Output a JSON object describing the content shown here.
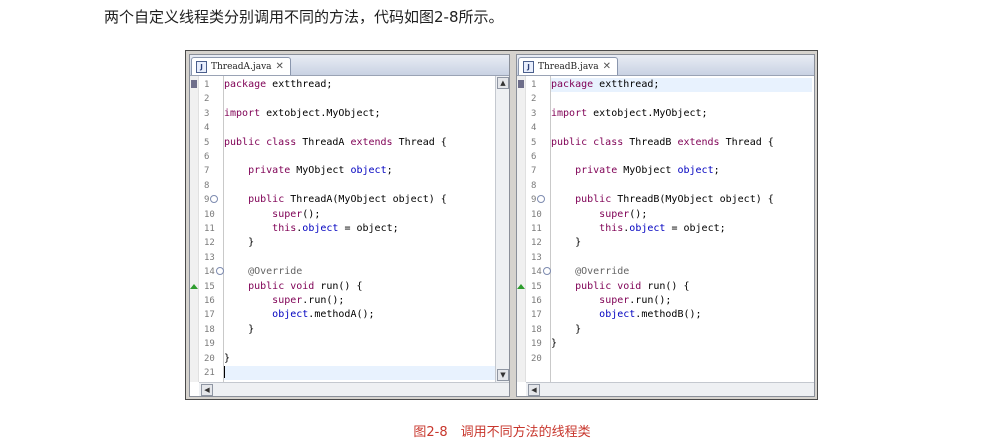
{
  "intro_text": "两个自定义线程类分别调用不同的方法，代码如图2-8所示。",
  "caption": "图2-8　调用不同方法的线程类",
  "editors": [
    {
      "tab_label": "ThreadA.java",
      "current_line": 21,
      "lines": [
        [
          {
            "t": "package",
            "c": "kw"
          },
          {
            "t": " extthread;"
          }
        ],
        [],
        [
          {
            "t": "import",
            "c": "kw"
          },
          {
            "t": " extobject.MyObject;"
          }
        ],
        [],
        [
          {
            "t": "public class",
            "c": "kw"
          },
          {
            "t": " ThreadA "
          },
          {
            "t": "extends",
            "c": "kw"
          },
          {
            "t": " Thread {"
          }
        ],
        [],
        [
          {
            "t": "    "
          },
          {
            "t": "private",
            "c": "kw"
          },
          {
            "t": " MyObject "
          },
          {
            "t": "object",
            "c": "fld"
          },
          {
            "t": ";"
          }
        ],
        [],
        [
          {
            "t": "    "
          },
          {
            "t": "public",
            "c": "kw"
          },
          {
            "t": " ThreadA(MyObject object) {"
          }
        ],
        [
          {
            "t": "        "
          },
          {
            "t": "super",
            "c": "kw"
          },
          {
            "t": "();"
          }
        ],
        [
          {
            "t": "        "
          },
          {
            "t": "this",
            "c": "kw"
          },
          {
            "t": "."
          },
          {
            "t": "object",
            "c": "fld"
          },
          {
            "t": " = object;"
          }
        ],
        [
          {
            "t": "    }"
          }
        ],
        [],
        [
          {
            "t": "    "
          },
          {
            "t": "@Override",
            "c": "ann"
          }
        ],
        [
          {
            "t": "    "
          },
          {
            "t": "public void",
            "c": "kw"
          },
          {
            "t": " run() {"
          }
        ],
        [
          {
            "t": "        "
          },
          {
            "t": "super",
            "c": "kw"
          },
          {
            "t": ".run();"
          }
        ],
        [
          {
            "t": "        "
          },
          {
            "t": "object",
            "c": "fld"
          },
          {
            "t": ".methodA();"
          }
        ],
        [
          {
            "t": "    }"
          }
        ],
        [],
        [
          {
            "t": "}"
          }
        ],
        []
      ]
    },
    {
      "tab_label": "ThreadB.java",
      "current_line": 1,
      "lines": [
        [
          {
            "t": "package",
            "c": "kw"
          },
          {
            "t": " extthread;"
          }
        ],
        [],
        [
          {
            "t": "import",
            "c": "kw"
          },
          {
            "t": " extobject.MyObject;"
          }
        ],
        [],
        [
          {
            "t": "public class",
            "c": "kw"
          },
          {
            "t": " ThreadB "
          },
          {
            "t": "extends",
            "c": "kw"
          },
          {
            "t": " Thread {"
          }
        ],
        [],
        [
          {
            "t": "    "
          },
          {
            "t": "private",
            "c": "kw"
          },
          {
            "t": " MyObject "
          },
          {
            "t": "object",
            "c": "fld"
          },
          {
            "t": ";"
          }
        ],
        [],
        [
          {
            "t": "    "
          },
          {
            "t": "public",
            "c": "kw"
          },
          {
            "t": " ThreadB(MyObject object) {"
          }
        ],
        [
          {
            "t": "        "
          },
          {
            "t": "super",
            "c": "kw"
          },
          {
            "t": "();"
          }
        ],
        [
          {
            "t": "        "
          },
          {
            "t": "this",
            "c": "kw"
          },
          {
            "t": "."
          },
          {
            "t": "object",
            "c": "fld"
          },
          {
            "t": " = object;"
          }
        ],
        [
          {
            "t": "    }"
          }
        ],
        [],
        [
          {
            "t": "    "
          },
          {
            "t": "@Override",
            "c": "ann"
          }
        ],
        [
          {
            "t": "    "
          },
          {
            "t": "public void",
            "c": "kw"
          },
          {
            "t": " run() {"
          }
        ],
        [
          {
            "t": "        "
          },
          {
            "t": "super",
            "c": "kw"
          },
          {
            "t": ".run();"
          }
        ],
        [
          {
            "t": "        "
          },
          {
            "t": "object",
            "c": "fld"
          },
          {
            "t": ".methodB();"
          }
        ],
        [
          {
            "t": "    }"
          }
        ],
        [
          {
            "t": "}"
          }
        ],
        []
      ]
    }
  ],
  "fold_lines": [
    9,
    14
  ],
  "override_line": 15,
  "colors": {
    "keyword": "#7f0055",
    "field": "#0000c0",
    "annotation": "#646464",
    "caption": "#c8372d"
  }
}
